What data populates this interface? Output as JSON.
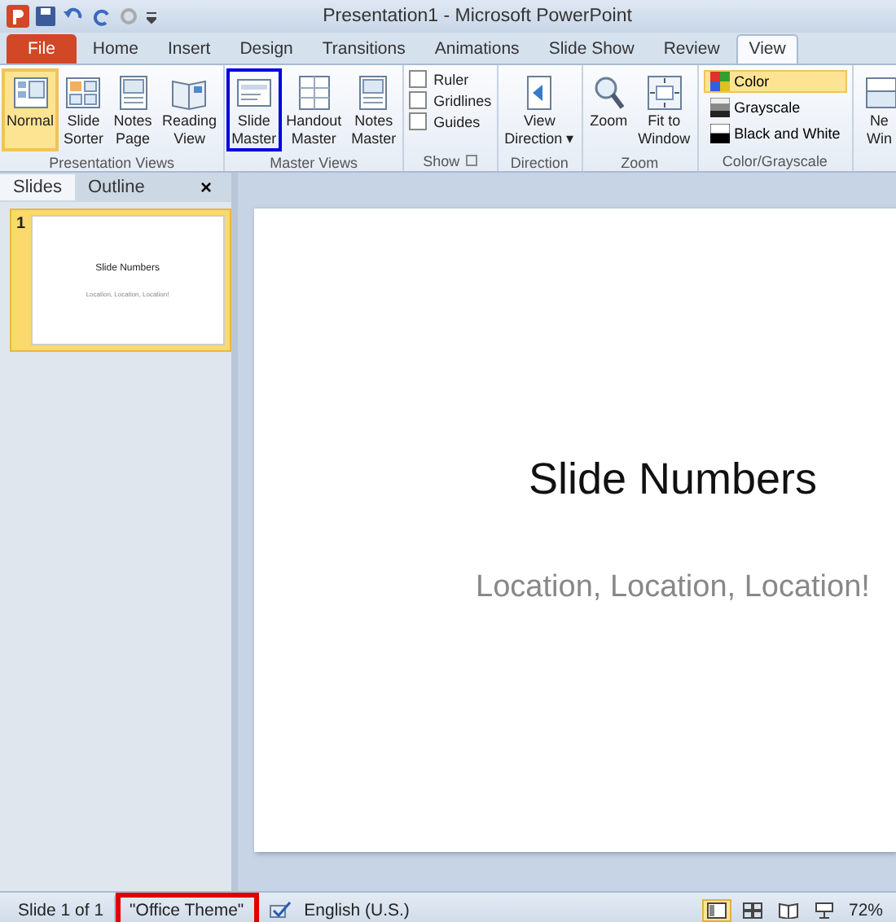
{
  "window": {
    "title": "Presentation1 - Microsoft PowerPoint"
  },
  "ribbon_tabs": [
    {
      "label": "File",
      "kind": "file",
      "selected": false
    },
    {
      "label": "Home",
      "kind": "tab",
      "selected": false
    },
    {
      "label": "Insert",
      "kind": "tab",
      "selected": false
    },
    {
      "label": "Design",
      "kind": "tab",
      "selected": false
    },
    {
      "label": "Transitions",
      "kind": "tab",
      "selected": false
    },
    {
      "label": "Animations",
      "kind": "tab",
      "selected": false
    },
    {
      "label": "Slide Show",
      "kind": "tab",
      "selected": false
    },
    {
      "label": "Review",
      "kind": "tab",
      "selected": false
    },
    {
      "label": "View",
      "kind": "tab",
      "selected": true
    }
  ],
  "groups": [
    {
      "label": "Presentation Views",
      "items": [
        {
          "kind": "large",
          "lines": [
            "Normal"
          ],
          "selected": true,
          "highlighted": false
        },
        {
          "kind": "large",
          "lines": [
            "Slide",
            "Sorter"
          ],
          "selected": false,
          "highlighted": false
        },
        {
          "kind": "large",
          "lines": [
            "Notes",
            "Page"
          ],
          "selected": false,
          "highlighted": false
        },
        {
          "kind": "large",
          "lines": [
            "Reading",
            "View"
          ],
          "selected": false,
          "highlighted": false
        }
      ]
    },
    {
      "label": "Master Views",
      "items": [
        {
          "kind": "large",
          "lines": [
            "Slide",
            "Master"
          ],
          "selected": false,
          "highlighted": true
        },
        {
          "kind": "large",
          "lines": [
            "Handout",
            "Master"
          ],
          "selected": false,
          "highlighted": false
        },
        {
          "kind": "large",
          "lines": [
            "Notes",
            "Master"
          ],
          "selected": false,
          "highlighted": false
        }
      ]
    },
    {
      "label": "Show",
      "items": [
        {
          "kind": "check",
          "label": "Ruler",
          "checked": false
        },
        {
          "kind": "check",
          "label": "Gridlines",
          "checked": false
        },
        {
          "kind": "check",
          "label": "Guides",
          "checked": false
        }
      ]
    },
    {
      "label": "Direction",
      "items": [
        {
          "kind": "large",
          "lines": [
            "View",
            "Direction ▾"
          ],
          "selected": false,
          "highlighted": false
        }
      ]
    },
    {
      "label": "Zoom",
      "items": [
        {
          "kind": "large",
          "lines": [
            "Zoom"
          ],
          "selected": false,
          "highlighted": false
        },
        {
          "kind": "large",
          "lines": [
            "Fit to",
            "Window"
          ],
          "selected": false,
          "highlighted": false
        }
      ]
    },
    {
      "label": "Color/Grayscale",
      "items": [
        {
          "kind": "small",
          "label": "Color",
          "selected": true
        },
        {
          "kind": "small",
          "label": "Grayscale",
          "selected": false
        },
        {
          "kind": "small",
          "label": "Black and White",
          "selected": false
        }
      ]
    },
    {
      "items": [
        {
          "kind": "large",
          "lines": [
            "Ne",
            "Win"
          ],
          "selected": false,
          "highlighted": false
        }
      ]
    }
  ],
  "pane": {
    "tabs": [
      {
        "label": "Slides",
        "selected": true
      },
      {
        "label": "Outline",
        "selected": false
      }
    ],
    "close": "×",
    "thumbnails": [
      {
        "number": "1",
        "title": "Slide Numbers",
        "subtitle": "Location, Location, Location!",
        "selected": true
      }
    ]
  },
  "slide": {
    "title": "Slide Numbers",
    "subtitle": "Location, Location, Location!"
  },
  "status_bar": {
    "items": [
      {
        "text": "Slide 1 of 1",
        "highlighted": false
      },
      {
        "text": "\"Office Theme\"",
        "highlighted": true
      }
    ],
    "language": "English (U.S.)",
    "views": [
      {
        "selected": true
      },
      {
        "selected": false
      },
      {
        "selected": false
      },
      {
        "selected": false
      }
    ],
    "zoom": "72%"
  }
}
